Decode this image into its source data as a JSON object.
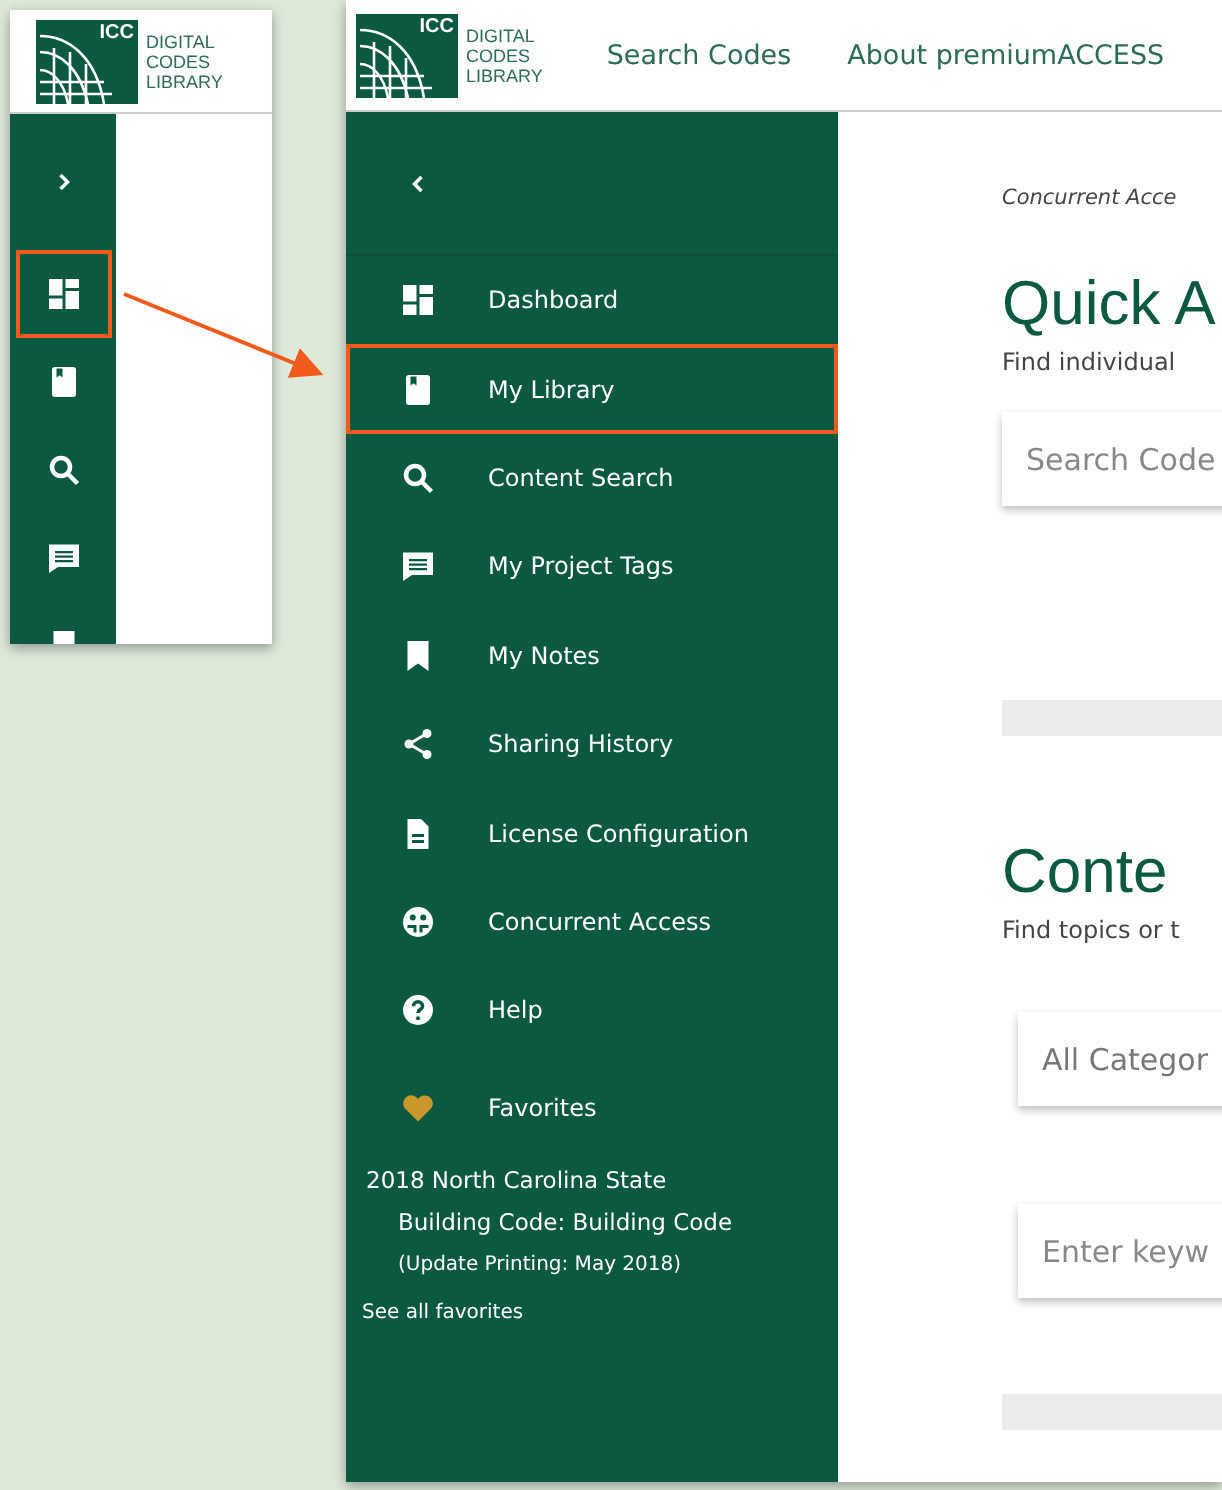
{
  "collapsed_view": {
    "logo": {
      "mark": "ICC",
      "lines": [
        "DIGITAL",
        "CODES",
        "LIBRARY"
      ]
    },
    "toggle": {
      "kind": "expand"
    },
    "items": [
      {
        "kind": "dashboard",
        "highlighted": true
      },
      {
        "kind": "library",
        "highlighted": false
      },
      {
        "kind": "search",
        "highlighted": false
      },
      {
        "kind": "tags",
        "highlighted": false
      },
      {
        "kind": "notes",
        "highlighted": false
      }
    ]
  },
  "expanded_view": {
    "logo": {
      "mark": "ICC",
      "lines": [
        "DIGITAL",
        "CODES",
        "LIBRARY"
      ]
    },
    "nav": [
      "Search Codes",
      "About premiumACCESS"
    ],
    "sidebar": {
      "toggle": {
        "kind": "collapse"
      },
      "items": [
        {
          "kind": "dashboard",
          "label": "Dashboard",
          "highlighted": false
        },
        {
          "kind": "library",
          "label": "My Library",
          "highlighted": true
        },
        {
          "kind": "search",
          "label": "Content Search",
          "highlighted": false
        },
        {
          "kind": "tags",
          "label": "My Project Tags",
          "highlighted": false
        },
        {
          "kind": "notes",
          "label": "My Notes",
          "highlighted": false
        },
        {
          "kind": "share",
          "label": "Sharing History",
          "highlighted": false
        },
        {
          "kind": "license",
          "label": "License Configuration",
          "highlighted": false
        },
        {
          "kind": "concurrent",
          "label": "Concurrent Access",
          "highlighted": false
        },
        {
          "kind": "help",
          "label": "Help",
          "highlighted": false
        },
        {
          "kind": "favorites",
          "label": "Favorites",
          "highlighted": false
        }
      ],
      "favorite": {
        "title": "2018 North Carolina State",
        "subtitle": "Building Code: Building Code",
        "note": "(Update Printing: May 2018)"
      },
      "see_all": "See all favorites"
    },
    "content": {
      "breadcrumb": "Concurrent Acce",
      "quick_access": {
        "heading": "Quick A",
        "description": "Find individual",
        "search": {
          "placeholder": "Search Code"
        }
      },
      "content_search": {
        "heading": "Conte",
        "description": "Find topics or t",
        "category": {
          "value": "All Categor"
        },
        "keywords": {
          "placeholder": "Enter keyw"
        }
      }
    }
  }
}
